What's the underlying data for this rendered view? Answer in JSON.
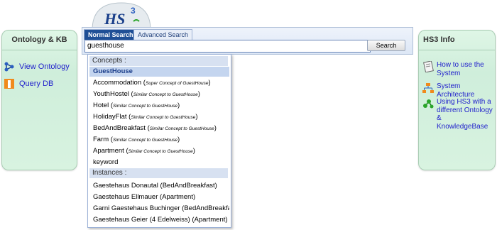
{
  "left_panel": {
    "title": "Ontology & KB",
    "items": [
      {
        "label": "View Ontology",
        "icon": "network-icon"
      },
      {
        "label": "Query DB",
        "icon": "database-icon"
      }
    ]
  },
  "right_panel": {
    "title": "HS3 Info",
    "items": [
      {
        "label_lines": [
          "How to use the",
          "System"
        ],
        "icon": "notebook-icon"
      },
      {
        "label_lines": [
          "System Architecture"
        ],
        "icon": "hierarchy-icon"
      },
      {
        "label_lines": [
          "Using HS3 with a",
          "different Ontology &",
          "KnowledgeBase"
        ],
        "icon": "network-icon"
      }
    ]
  },
  "logo": {
    "text": "HS",
    "superscript": "3"
  },
  "search": {
    "tabs": [
      "Normal Search",
      "Advanced Search"
    ],
    "active_tab": "Normal Search",
    "query": "guesthouse",
    "button_label": "Search"
  },
  "dropdown": {
    "concepts_header": "Concepts :",
    "concepts": [
      {
        "name": "GuestHouse",
        "note": "",
        "selected": true
      },
      {
        "name": "Accommodation",
        "note": "Super Concept of GuestHouse"
      },
      {
        "name": "YouthHostel",
        "note": "Similar Concept to GuestHouse"
      },
      {
        "name": "Hotel",
        "note": "Similar Concept to GuestHouse"
      },
      {
        "name": "HolidayFlat",
        "note": "Similar Concept to GuestHouse"
      },
      {
        "name": "BedAndBreakfast",
        "note": "Similar Concept to GuestHouse"
      },
      {
        "name": "Farm",
        "note": "Similar Concept to GuestHouse"
      },
      {
        "name": "Apartment",
        "note": "Similar Concept to GuestHouse"
      },
      {
        "name": "keyword",
        "note": ""
      }
    ],
    "instances_header": "Instances :",
    "instances": [
      "Gaestehaus Donautal (BedAndBreakfast)",
      "Gaestehaus Ellmauer (Apartment)",
      "Garni Gaestehaus Buchinger (BedAndBreakfast)",
      "Gaestehaus Geier (4 Edelweiss) (Apartment)"
    ]
  },
  "colors": {
    "panel_bg": "#d8f3e0",
    "link": "#2222cc",
    "tab_active": "#1f4f96",
    "selection": "#c4d5ef"
  }
}
